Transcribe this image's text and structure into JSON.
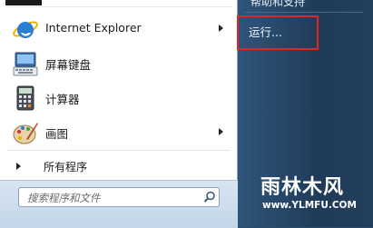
{
  "left_pane": {
    "items": [
      {
        "label": "Internet Explorer",
        "icon": "internet-explorer-icon",
        "has_submenu": true
      },
      {
        "label": "屏幕键盘",
        "icon": "on-screen-keyboard-icon",
        "has_submenu": false
      },
      {
        "label": "计算器",
        "icon": "calculator-icon",
        "has_submenu": false
      },
      {
        "label": "画图",
        "icon": "paint-icon",
        "has_submenu": true
      }
    ],
    "all_programs": "所有程序",
    "search_placeholder": "搜索程序和文件"
  },
  "right_pane": {
    "cut_item": "帮助和支持",
    "run_label": "运行..."
  },
  "watermark": {
    "logo": "雨林木风",
    "url": "www.YLMFU.COM"
  },
  "colors": {
    "highlight": "#e02528",
    "right_pane_bg": "#2a4d6e"
  }
}
